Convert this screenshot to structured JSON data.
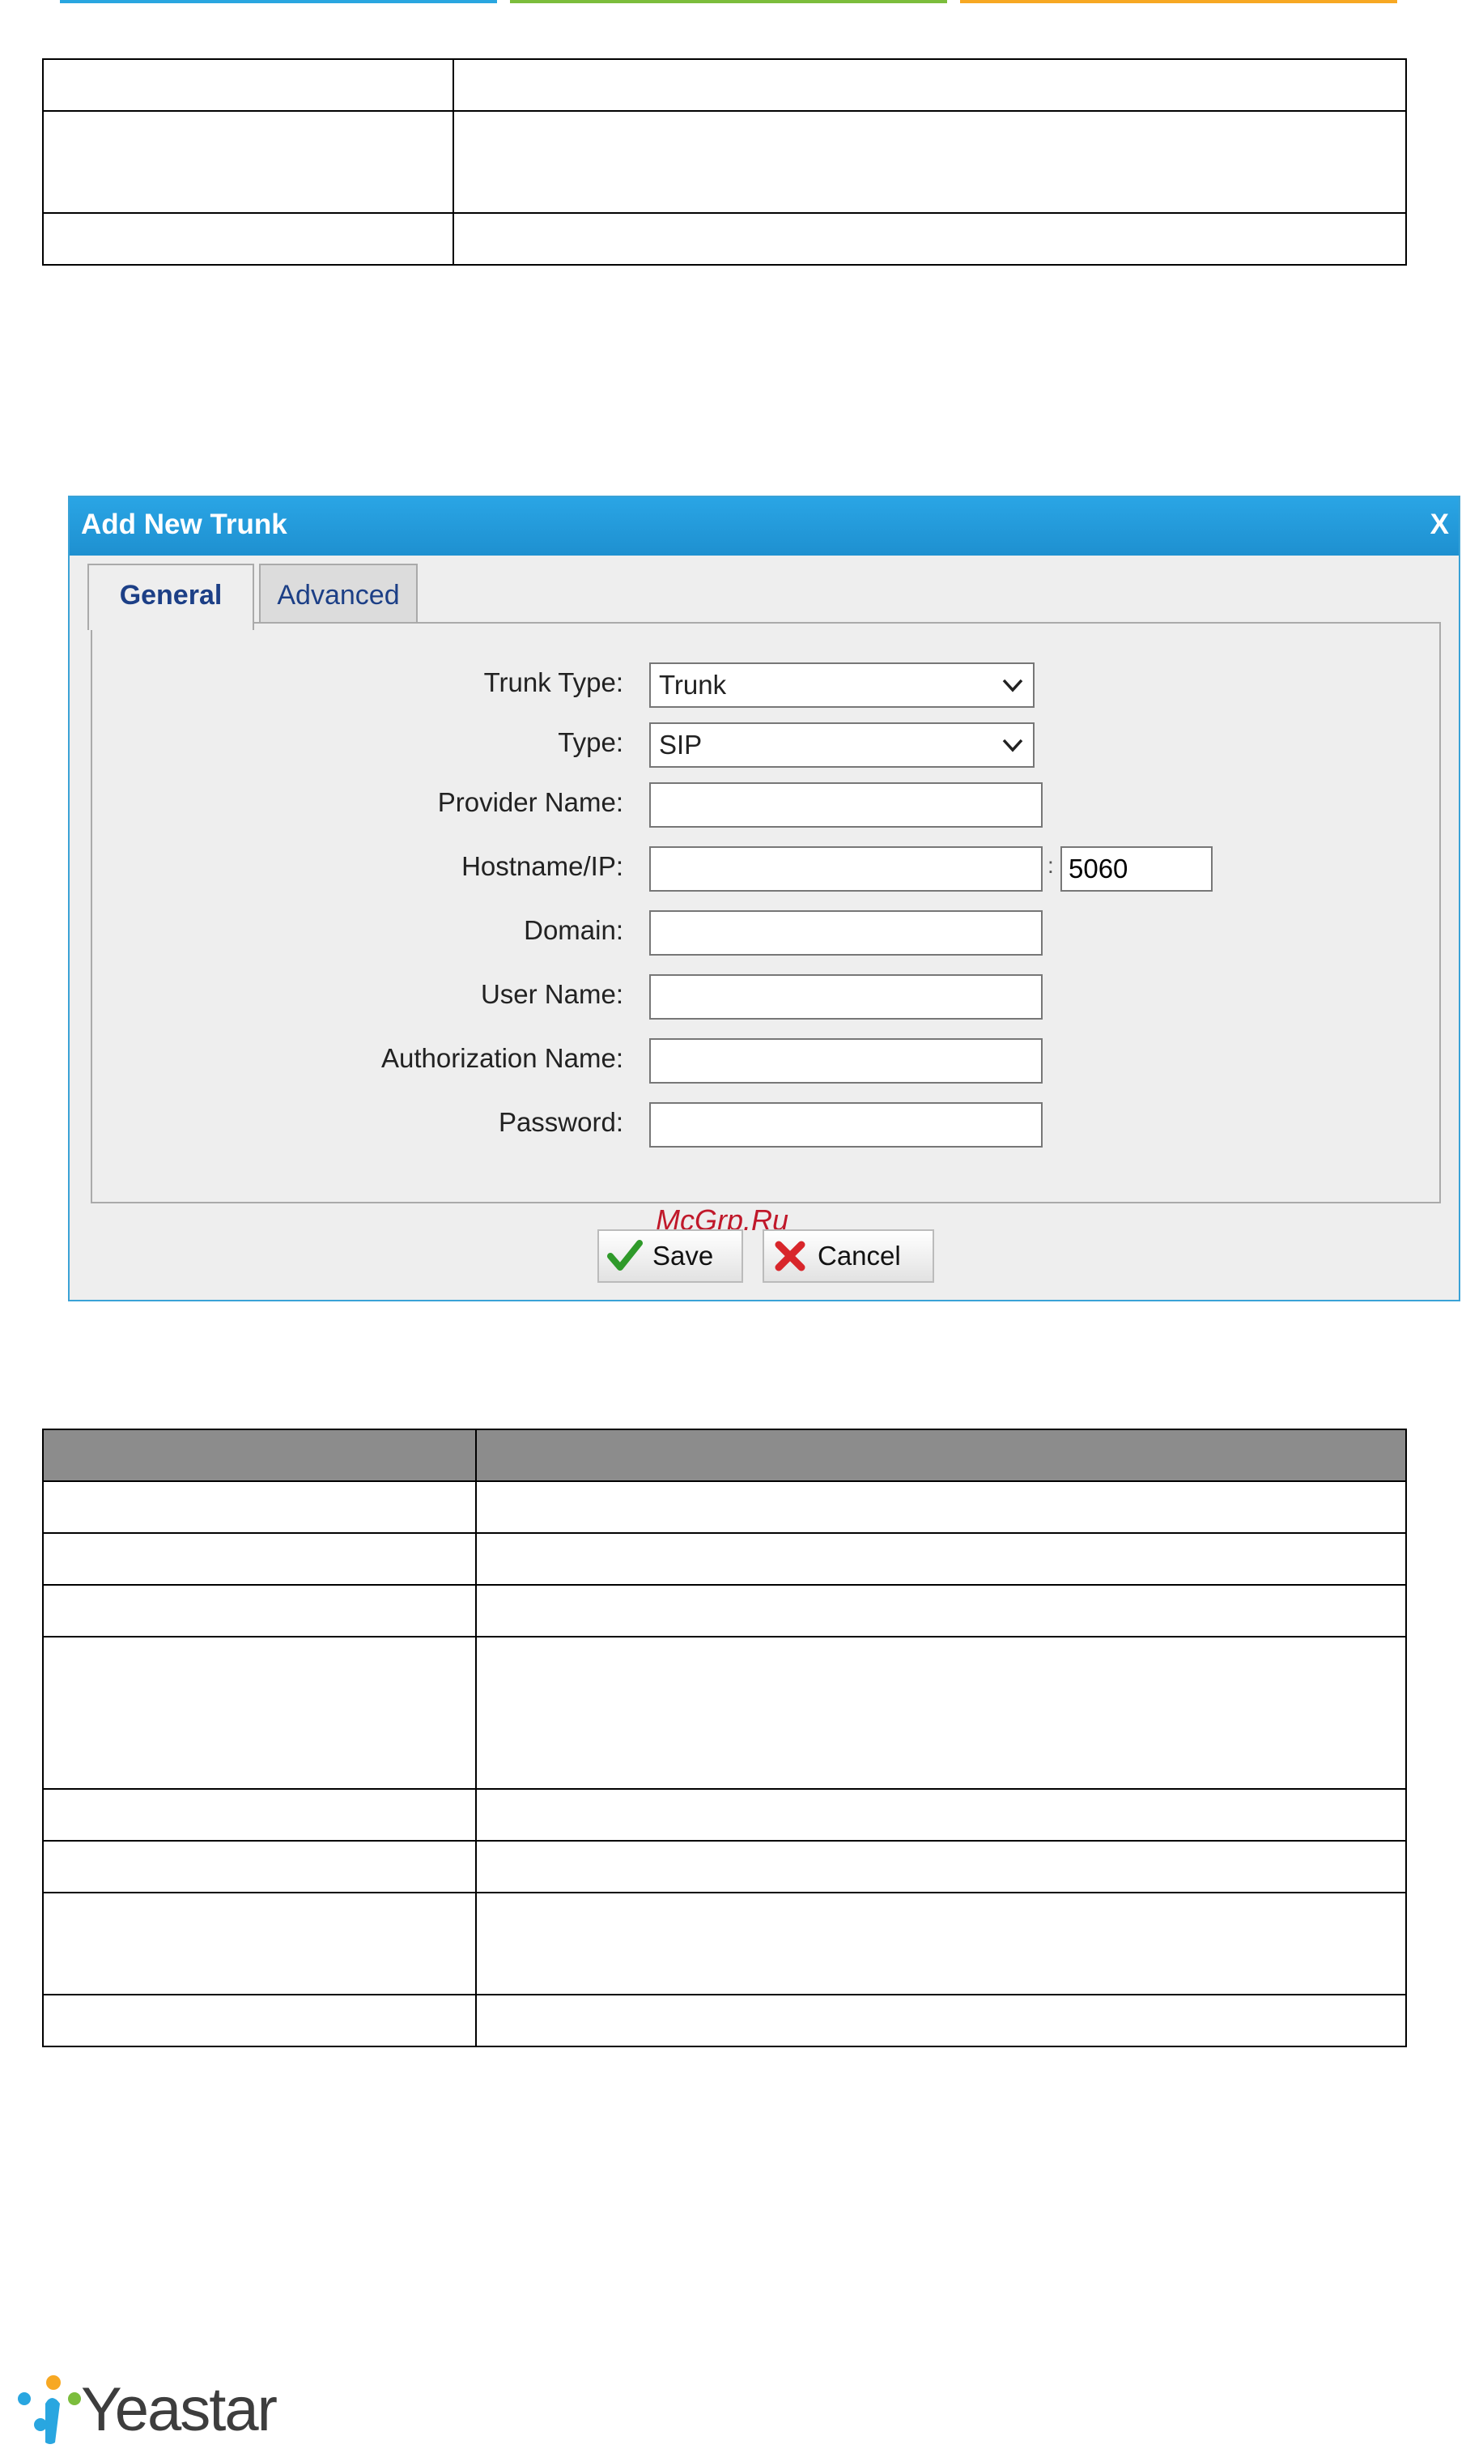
{
  "colors": {
    "bar_blue": "#29a6e0",
    "bar_green": "#7cbd3c",
    "bar_orange": "#f7a823"
  },
  "dialog": {
    "title": "Add New Trunk",
    "close": "X",
    "tabs": [
      "General",
      "Advanced"
    ],
    "fields": {
      "trunk_type": {
        "label": "Trunk Type:",
        "value": "Trunk"
      },
      "type": {
        "label": "Type:",
        "value": "SIP"
      },
      "provider_name": {
        "label": "Provider Name:",
        "value": ""
      },
      "hostname": {
        "label": "Hostname/IP:",
        "value": "",
        "colon": ":",
        "port": "5060"
      },
      "domain": {
        "label": "Domain:",
        "value": ""
      },
      "user_name": {
        "label": "User Name:",
        "value": ""
      },
      "auth_name": {
        "label": "Authorization Name:",
        "value": ""
      },
      "password": {
        "label": "Password:",
        "value": ""
      }
    },
    "buttons": {
      "save": "Save",
      "cancel": "Cancel"
    },
    "watermark": "McGrp.Ru"
  },
  "logo": {
    "text": "Yeastar"
  }
}
